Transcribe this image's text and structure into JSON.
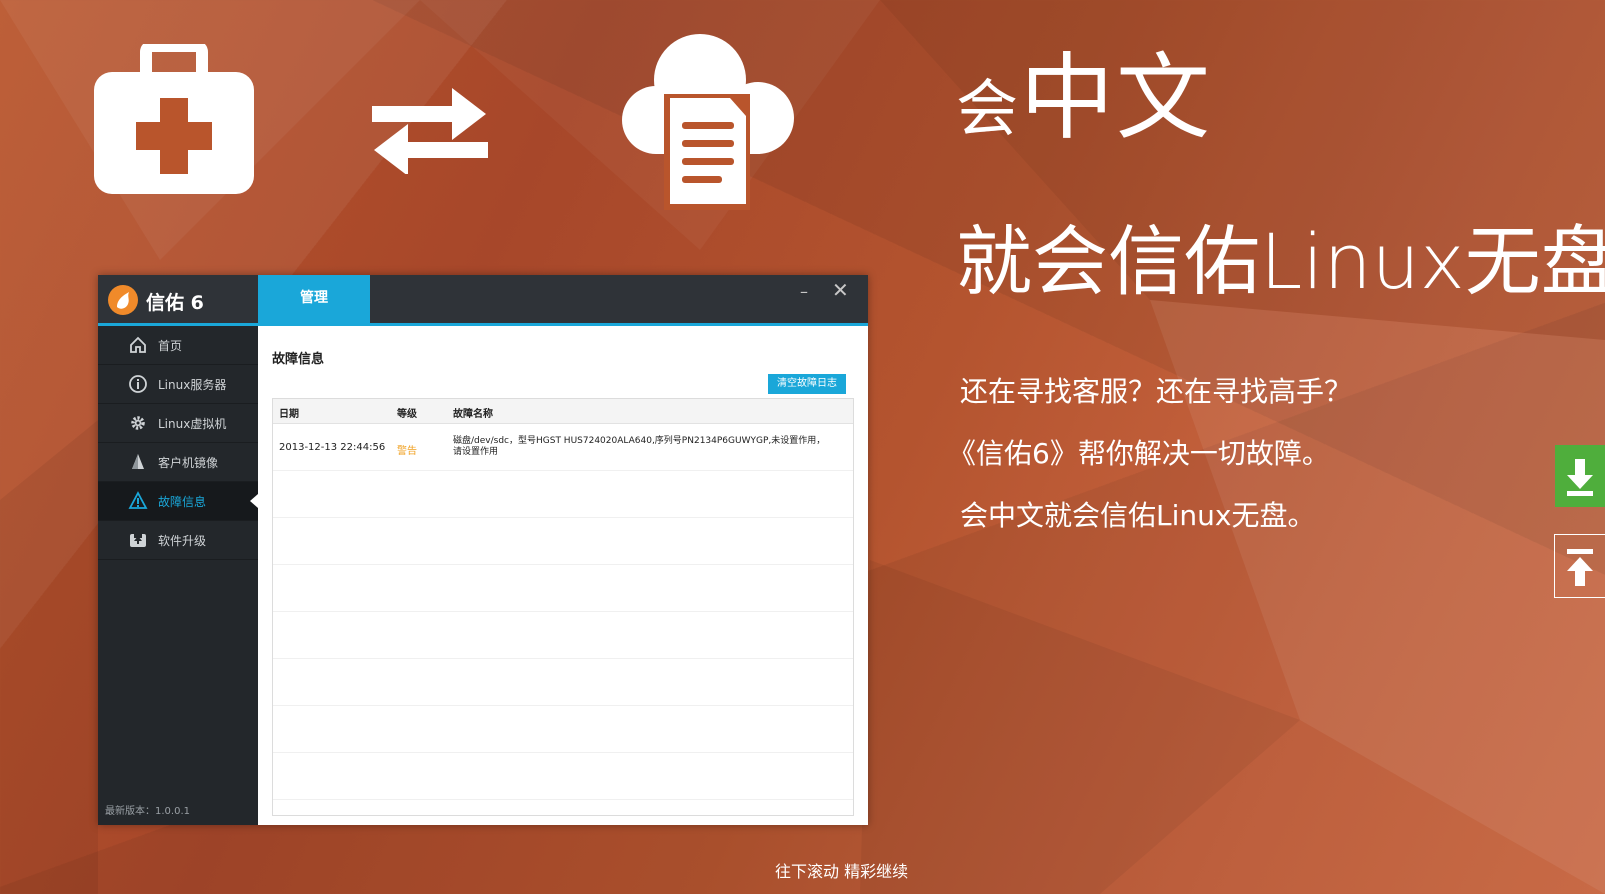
{
  "headline": {
    "line1_small": "会",
    "line1_big": "中文",
    "line2": "就会信佑Linux无盘"
  },
  "taglines": [
    "还在寻找客服？还在寻找高手？",
    "《信佑6》帮你解决一切故障。",
    "会中文就会信佑Linux无盘。"
  ],
  "scroll_hint": "往下滚动 精彩继续",
  "hero_icons": [
    "first-aid-kit-icon",
    "swap-arrows-icon",
    "cloud-document-icon"
  ],
  "side_buttons": [
    "download-icon",
    "back-to-top-icon"
  ],
  "app": {
    "name": "信佑 6",
    "tab": "管理",
    "window_controls": {
      "minimize": "–",
      "close": "✕"
    },
    "nav": [
      {
        "label": "首页",
        "icon": "home-icon"
      },
      {
        "label": "Linux服务器",
        "icon": "info-icon"
      },
      {
        "label": "Linux虚拟机",
        "icon": "gear-icon"
      },
      {
        "label": "客户机镜像",
        "icon": "image-icon"
      },
      {
        "label": "故障信息",
        "icon": "warning-icon",
        "active": true
      },
      {
        "label": "软件升级",
        "icon": "upgrade-icon"
      }
    ],
    "version": "最新版本：1.0.0.1",
    "content": {
      "title": "故障信息",
      "clear_button": "清空故障日志",
      "columns": [
        "日期",
        "等级",
        "故障名称"
      ],
      "rows": [
        {
          "date": "2013-12-13 22:44:56",
          "level": "警告",
          "name": "磁盘/dev/sdc，型号HGST HUS724020ALA640,序列号PN2134P6GUWYGP,未设置作用，请设置作用"
        }
      ]
    }
  },
  "colors": {
    "accent": "#1aa7d9",
    "background": "#b4542f",
    "warning": "#f0a020",
    "download": "#4fae3c"
  }
}
